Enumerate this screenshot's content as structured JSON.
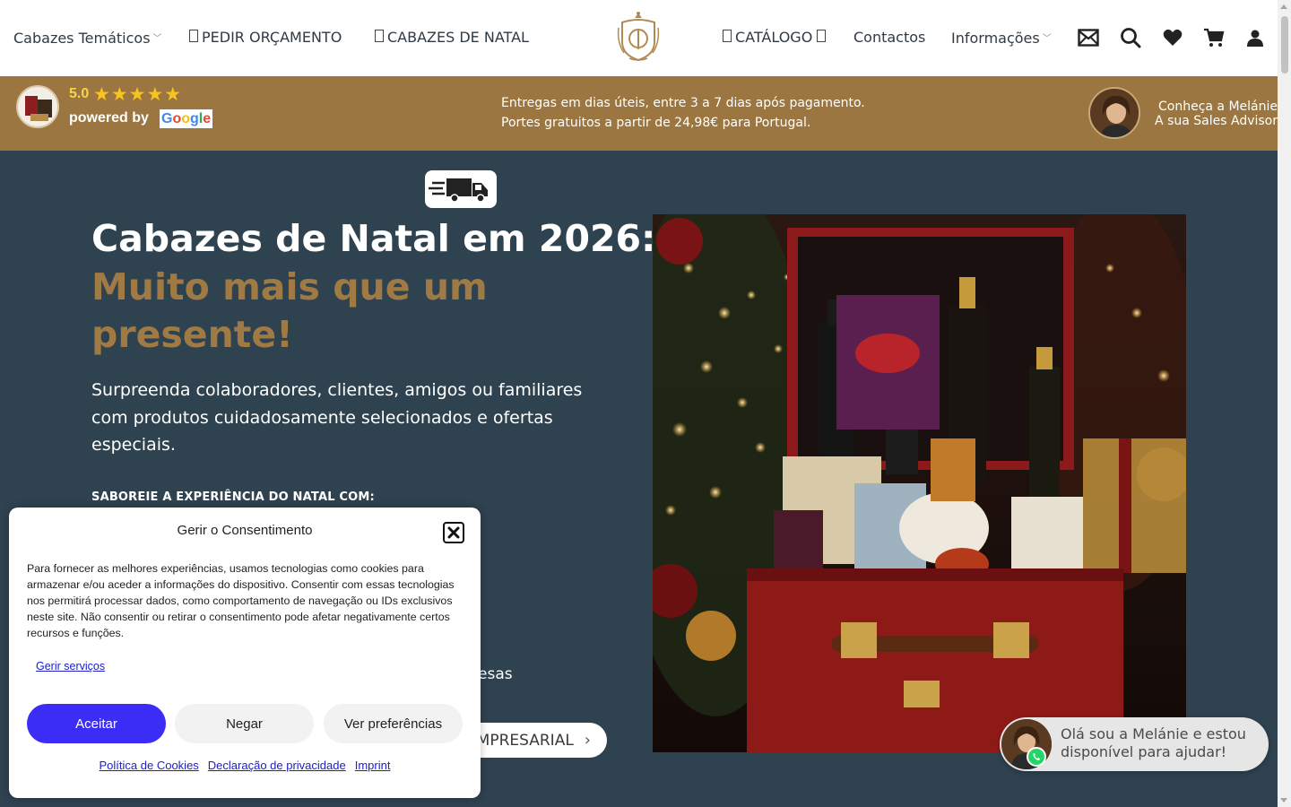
{
  "nav": {
    "items": [
      {
        "label": "Cabazes Temáticos",
        "has_dropdown": true
      },
      {
        "label": "PEDIR ORÇAMENTO",
        "icon": "unknown-glyph-icon"
      },
      {
        "label": "CABAZES DE NATAL",
        "icon": "unknown-glyph-icon"
      },
      {
        "label": "CATÁLOGO",
        "icon": "unknown-glyph-icon"
      },
      {
        "label": "Contactos",
        "has_dropdown": false
      },
      {
        "label": "Informações",
        "has_dropdown": true
      }
    ],
    "glyph_placeholder": "",
    "icons": [
      "mail-icon",
      "search-icon",
      "heart-icon",
      "cart-icon",
      "user-icon"
    ]
  },
  "infobar": {
    "rating": "5.0",
    "stars": "★★★★★",
    "powered_by": "powered by",
    "google": "Google",
    "delivery_line1": "Entregas em dias úteis, entre 3 a 7 dias após pagamento.",
    "delivery_line2": "Portes gratuitos a partir de 24,98€ para Portugal.",
    "advisor_line1": "Conheça a Melánie",
    "advisor_line2": "A sua Sales Advisor"
  },
  "hero": {
    "title": "Cabazes de Natal em 2026:",
    "accent": "Muito mais que um presente!",
    "description": "Surpreenda colaboradores, clientes, amigos ou familiares com produtos cuidadosamente selecionados e ofertas especiais.",
    "subheading": "SABOREIE A EXPERIÊNCIA DO NATAL COM:",
    "partial_text": "esas",
    "cta_label": "MPRESARIAL",
    "cta_arrow": "›"
  },
  "whatsapp": {
    "message": "Olá sou a Melánie e estou disponível para ajudar!"
  },
  "consent": {
    "title": "Gerir o Consentimento",
    "body": "Para fornecer as melhores experiências, usamos tecnologias como cookies para armazenar e/ou aceder a informações do dispositivo. Consentir com essas tecnologias nos permitirá processar dados, como comportamento de navegação ou IDs exclusivos neste site. Não consentir ou retirar o consentimento pode afetar negativamente certos recursos e funções.",
    "manage_link": "Gerir serviços",
    "accept": "Aceitar",
    "deny": "Negar",
    "preferences": "Ver preferências",
    "links": [
      "Política de Cookies",
      "Declaração de privacidade",
      "Imprint"
    ]
  },
  "colors": {
    "header_bg": "#ffffff",
    "infobar_bg": "#9c7640",
    "hero_bg": "#2f4250",
    "accent_gold": "#a07a45",
    "accept_blue": "#3b2df5",
    "star_yellow": "#f7c51e"
  }
}
